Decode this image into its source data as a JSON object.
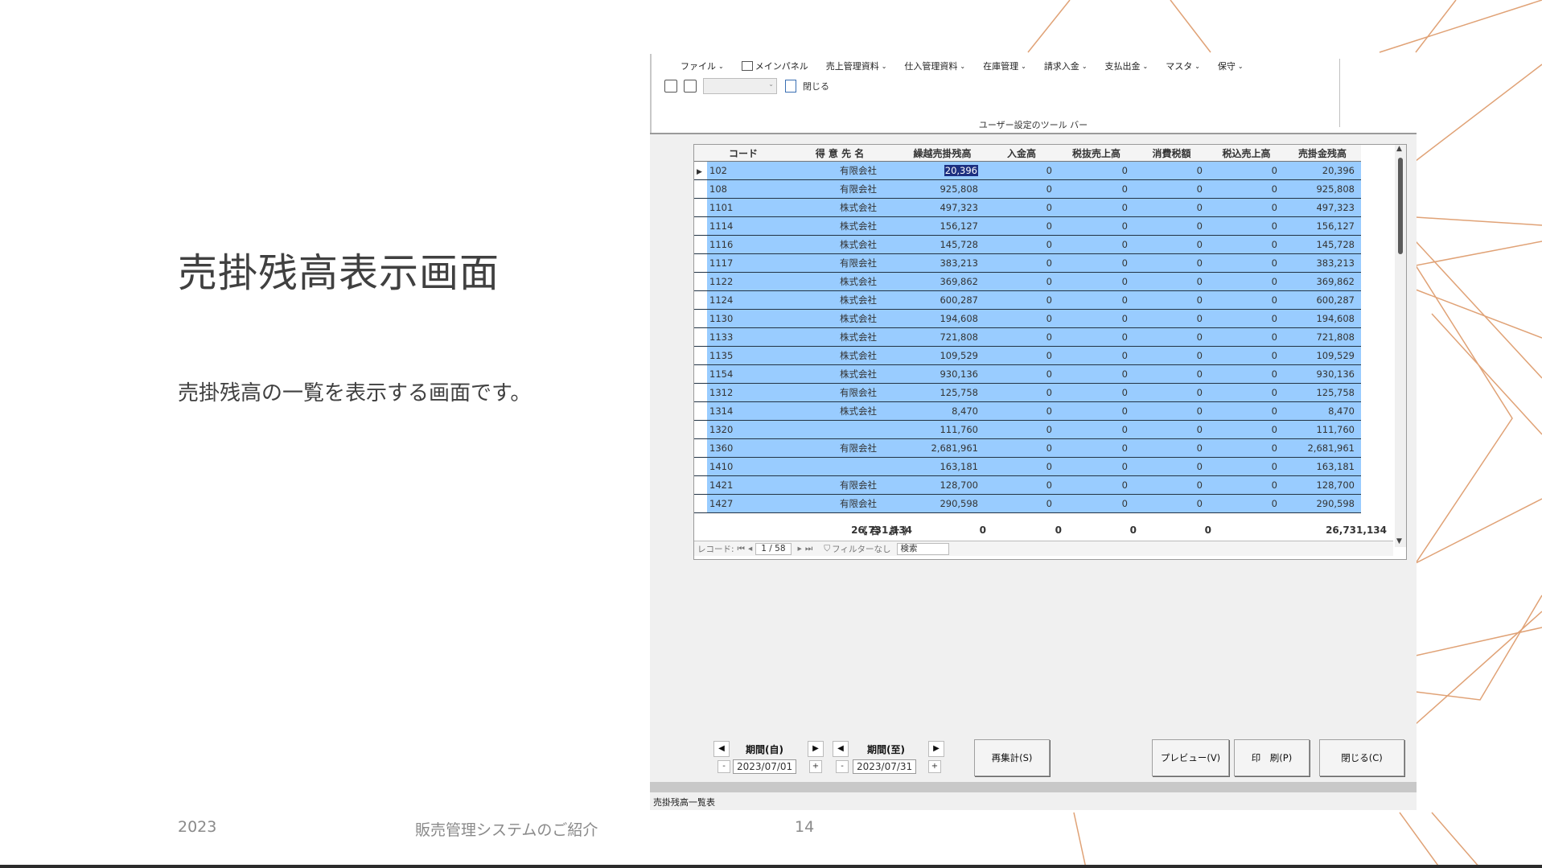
{
  "slide": {
    "title": "売掛残高表示画面",
    "description": "売掛残高の一覧を表示する画面です。",
    "footer_year": "2023",
    "footer_center": "販売管理システムのご紹介",
    "page_number": "14",
    "accent_line_color": "#e0a276"
  },
  "app": {
    "menu": [
      {
        "label": "ファイル",
        "chevron": true
      },
      {
        "label": "メインパネル",
        "chevron": false,
        "icon": "panel-icon"
      },
      {
        "label": "売上管理資料",
        "chevron": true
      },
      {
        "label": "仕入管理資料",
        "chevron": true
      },
      {
        "label": "在庫管理",
        "chevron": true
      },
      {
        "label": "請求入金",
        "chevron": true
      },
      {
        "label": "支払出金",
        "chevron": true
      },
      {
        "label": "マスタ",
        "chevron": true
      },
      {
        "label": "保守",
        "chevron": true
      }
    ],
    "toolbar": {
      "close_label": "閉じる",
      "group_label": "ユーザー設定のツール バー"
    },
    "grid": {
      "columns": [
        "コード",
        "得 意 先 名",
        "繰越売掛残高",
        "入金高",
        "税抜売上高",
        "消費税額",
        "税込売上高",
        "売掛金残高"
      ],
      "rows": [
        {
          "code": "102",
          "type": "有限会社",
          "carry": "20,396",
          "paid": "0",
          "net": "0",
          "tax": "0",
          "gross": "0",
          "balance": "20,396"
        },
        {
          "code": "108",
          "type": "有限会社",
          "carry": "925,808",
          "paid": "0",
          "net": "0",
          "tax": "0",
          "gross": "0",
          "balance": "925,808"
        },
        {
          "code": "1101",
          "type": "株式会社",
          "carry": "497,323",
          "paid": "0",
          "net": "0",
          "tax": "0",
          "gross": "0",
          "balance": "497,323"
        },
        {
          "code": "1114",
          "type": "株式会社",
          "carry": "156,127",
          "paid": "0",
          "net": "0",
          "tax": "0",
          "gross": "0",
          "balance": "156,127"
        },
        {
          "code": "1116",
          "type": "株式会社",
          "carry": "145,728",
          "paid": "0",
          "net": "0",
          "tax": "0",
          "gross": "0",
          "balance": "145,728"
        },
        {
          "code": "1117",
          "type": "有限会社",
          "carry": "383,213",
          "paid": "0",
          "net": "0",
          "tax": "0",
          "gross": "0",
          "balance": "383,213"
        },
        {
          "code": "1122",
          "type": "株式会社",
          "carry": "369,862",
          "paid": "0",
          "net": "0",
          "tax": "0",
          "gross": "0",
          "balance": "369,862"
        },
        {
          "code": "1124",
          "type": "株式会社",
          "carry": "600,287",
          "paid": "0",
          "net": "0",
          "tax": "0",
          "gross": "0",
          "balance": "600,287"
        },
        {
          "code": "1130",
          "type": "株式会社",
          "carry": "194,608",
          "paid": "0",
          "net": "0",
          "tax": "0",
          "gross": "0",
          "balance": "194,608"
        },
        {
          "code": "1133",
          "type": "株式会社",
          "carry": "721,808",
          "paid": "0",
          "net": "0",
          "tax": "0",
          "gross": "0",
          "balance": "721,808"
        },
        {
          "code": "1135",
          "type": "株式会社",
          "carry": "109,529",
          "paid": "0",
          "net": "0",
          "tax": "0",
          "gross": "0",
          "balance": "109,529"
        },
        {
          "code": "1154",
          "type": "株式会社",
          "carry": "930,136",
          "paid": "0",
          "net": "0",
          "tax": "0",
          "gross": "0",
          "balance": "930,136"
        },
        {
          "code": "1312",
          "type": "有限会社",
          "carry": "125,758",
          "paid": "0",
          "net": "0",
          "tax": "0",
          "gross": "0",
          "balance": "125,758"
        },
        {
          "code": "1314",
          "type": "株式会社",
          "carry": "8,470",
          "paid": "0",
          "net": "0",
          "tax": "0",
          "gross": "0",
          "balance": "8,470"
        },
        {
          "code": "1320",
          "type": "",
          "carry": "111,760",
          "paid": "0",
          "net": "0",
          "tax": "0",
          "gross": "0",
          "balance": "111,760"
        },
        {
          "code": "1360",
          "type": "有限会社",
          "carry": "2,681,961",
          "paid": "0",
          "net": "0",
          "tax": "0",
          "gross": "0",
          "balance": "2,681,961"
        },
        {
          "code": "1410",
          "type": "",
          "carry": "163,181",
          "paid": "0",
          "net": "0",
          "tax": "0",
          "gross": "0",
          "balance": "163,181"
        },
        {
          "code": "1421",
          "type": "有限会社",
          "carry": "128,700",
          "paid": "0",
          "net": "0",
          "tax": "0",
          "gross": "0",
          "balance": "128,700"
        },
        {
          "code": "1427",
          "type": "有限会社",
          "carry": "290,598",
          "paid": "0",
          "net": "0",
          "tax": "0",
          "gross": "0",
          "balance": "290,598"
        }
      ],
      "total": {
        "label": "《 合　計 》",
        "carry": "26,731,134",
        "paid": "0",
        "net": "0",
        "tax": "0",
        "gross": "0",
        "balance": "26,731,134"
      },
      "nav": {
        "record_label": "レコード:",
        "position": "1 / 58",
        "filter_label": "フィルターなし",
        "search_label": "検索"
      },
      "row_color": "#99ccff"
    },
    "period_from": {
      "label": "期間(自)",
      "value": "2023/07/01"
    },
    "period_to": {
      "label": "期間(至)",
      "value": "2023/07/31"
    },
    "buttons": {
      "recalc": "再集計(S)",
      "preview": "プレビュー(V)",
      "print": "印　刷(P)",
      "close": "閉じる(C)"
    },
    "status_text": "売掛残高一覧表"
  }
}
